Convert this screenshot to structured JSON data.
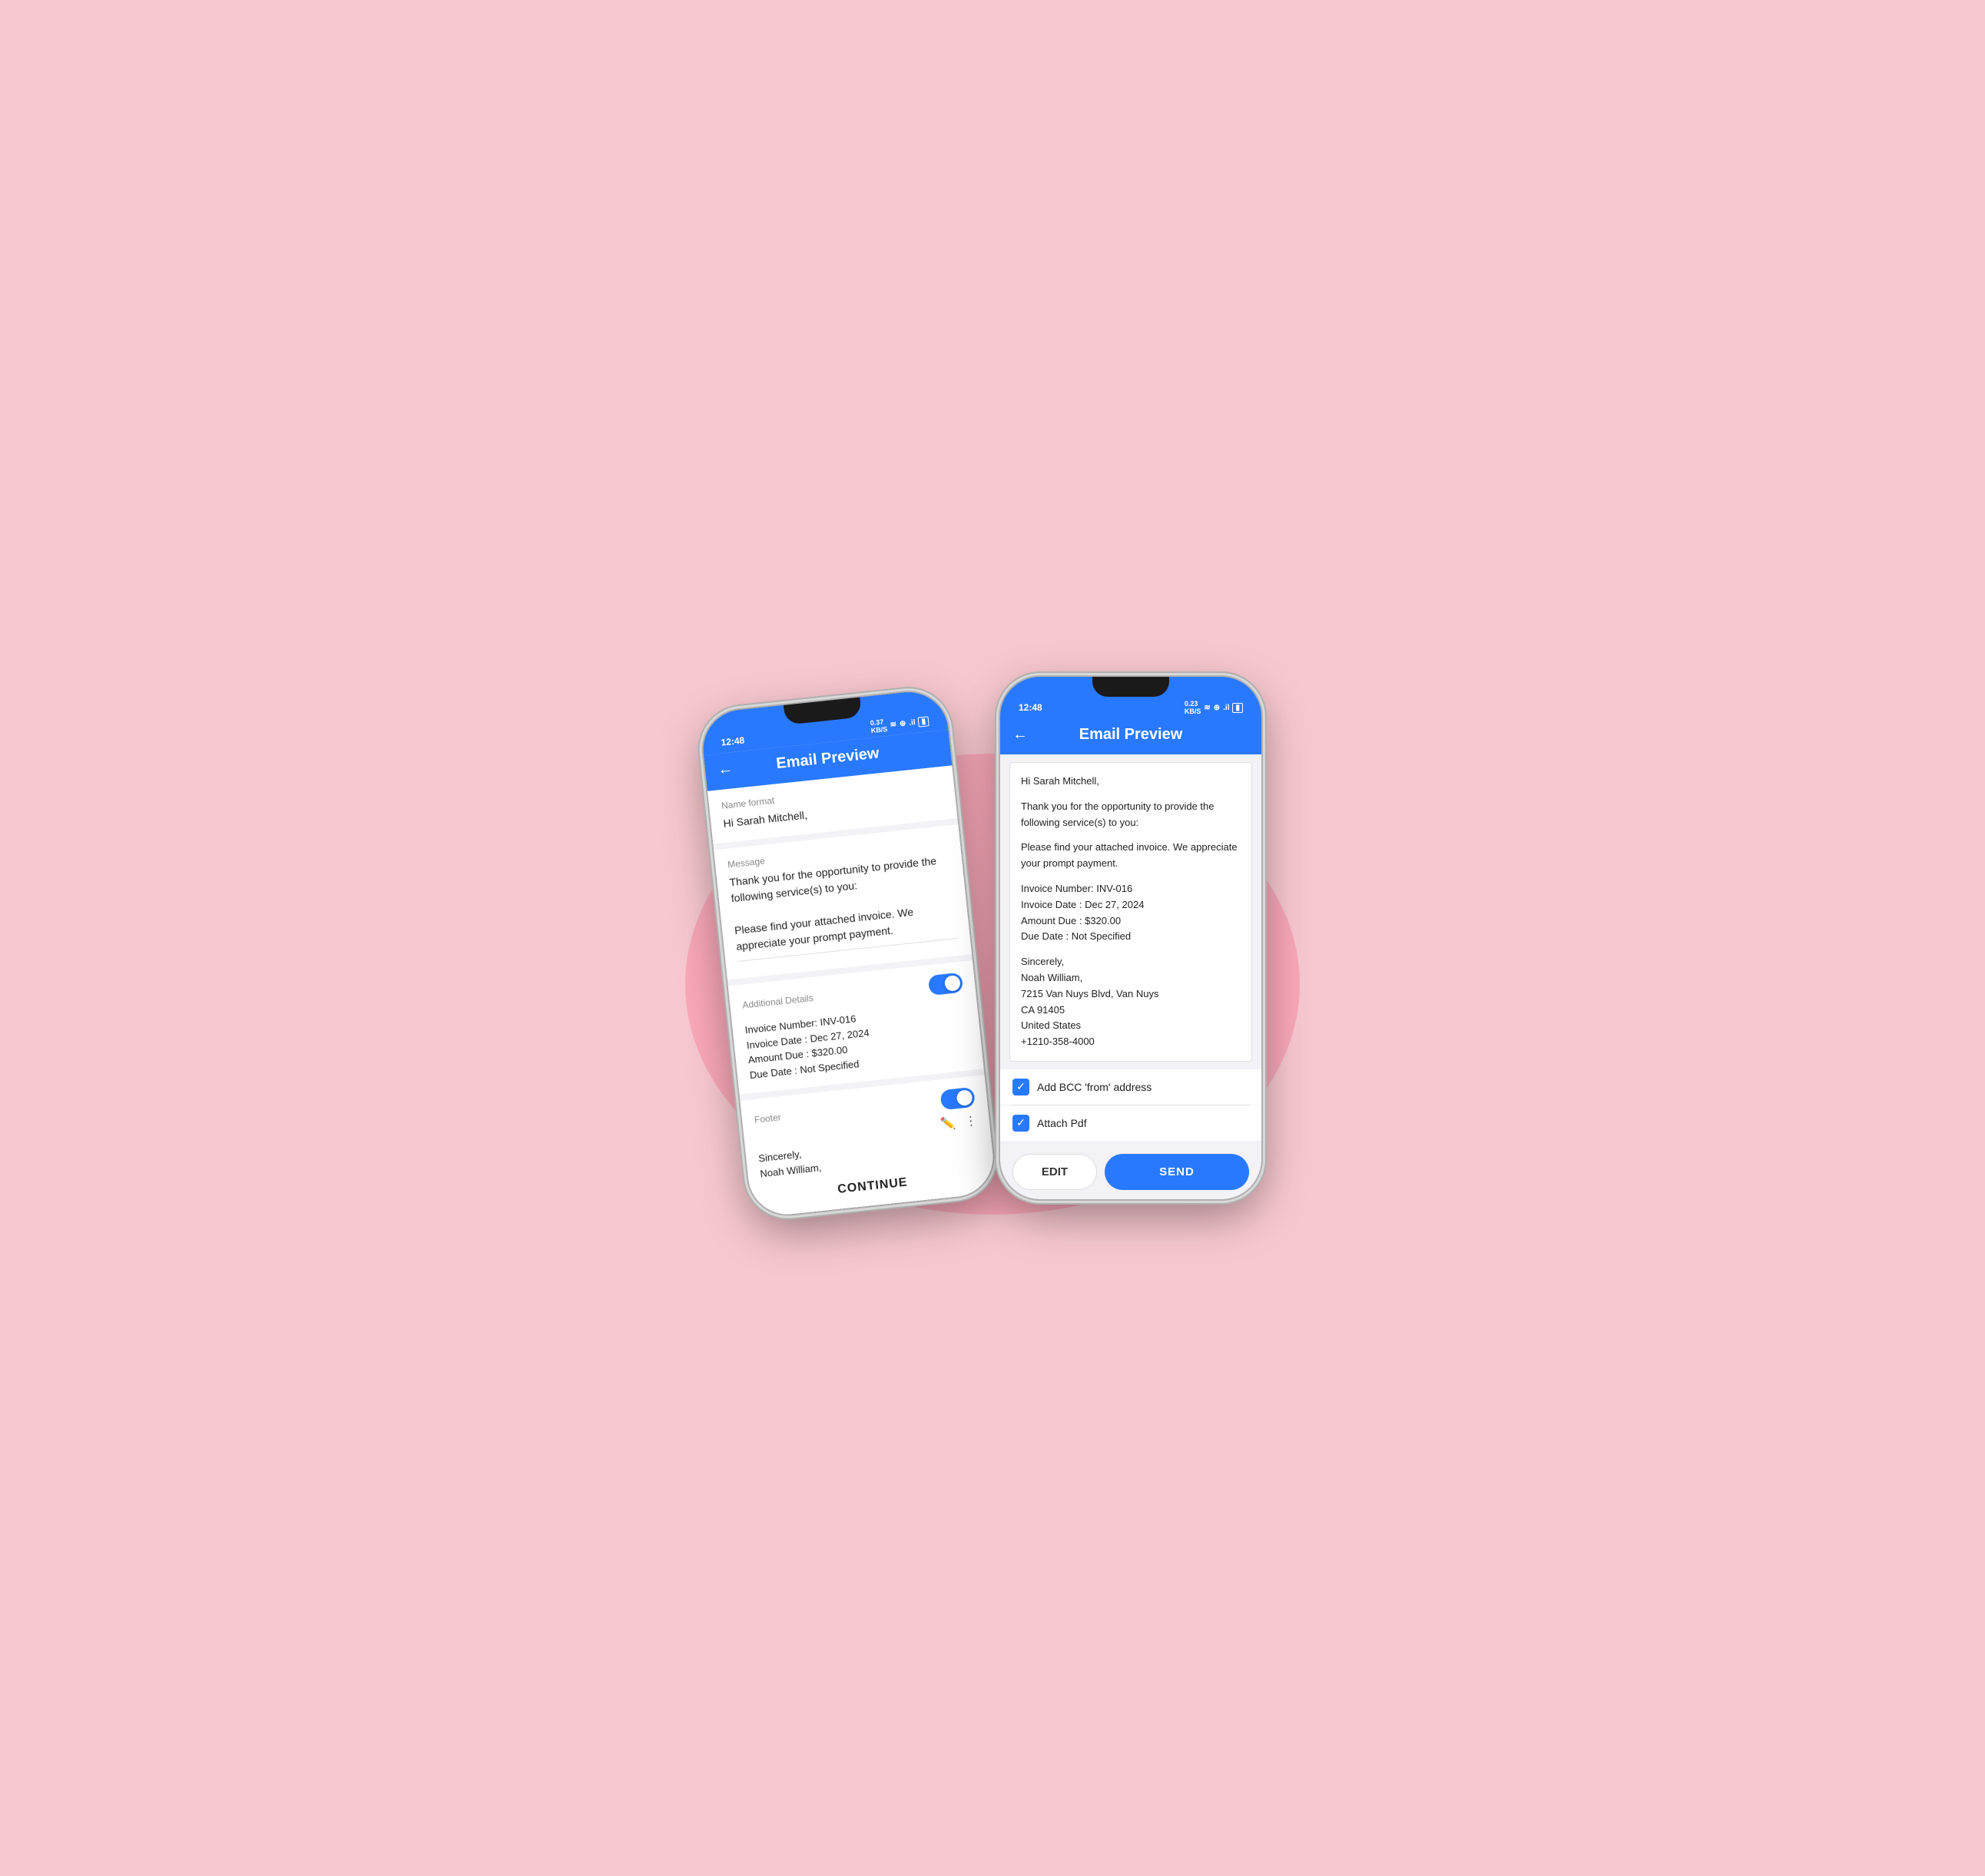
{
  "scene": {
    "background_color": "#f8c8d0"
  },
  "left_phone": {
    "status_bar": {
      "time": "12:48",
      "icons": "0.37 KB/S ≋ ⊕ .il 🔋"
    },
    "header": {
      "back_label": "←",
      "title": "Email Preview"
    },
    "sections": [
      {
        "id": "name_format",
        "label": "Name format",
        "value": "Hi Sarah Mitchell,"
      },
      {
        "id": "message",
        "label": "Message",
        "value": "Thank you for the opportunity to provide the following service(s) to you:\n\nPlease find your attached invoice. We appreciate your prompt payment."
      },
      {
        "id": "additional_details",
        "label": "Additional Details",
        "toggle": true,
        "toggle_on": true,
        "value": "Invoice Number: INV-016\nInvoice Date : Dec 27, 2024\nAmount Due : $320.00\nDue Date : Not Specified"
      },
      {
        "id": "footer",
        "label": "Footer",
        "toggle": true,
        "toggle_on": true,
        "has_edit_icons": true,
        "value": "Sincerely,\nNoah William,"
      }
    ],
    "continue_button_label": "CONTINUE"
  },
  "right_phone": {
    "status_bar": {
      "time": "12:48",
      "icons": "0.23 KB/S ≋ ⊕ .il 🔋"
    },
    "header": {
      "back_label": "←",
      "title": "Email Preview"
    },
    "email_preview": {
      "greeting": "Hi Sarah Mitchell,",
      "paragraph1": "Thank you for the opportunity to provide the following service(s) to you:",
      "paragraph2": "Please find your attached invoice. We appreciate your prompt payment.",
      "invoice_number": "Invoice Number: INV-016",
      "invoice_date": "Invoice Date : Dec 27, 2024",
      "amount_due": "Amount Due : $320.00",
      "due_date": "Due Date : Not Specified",
      "footer_greeting": "Sincerely,",
      "footer_name": "Noah William,",
      "footer_address1": "7215 Van Nuys Blvd, Van Nuys",
      "footer_address2": "CA 91405",
      "footer_country": "United States",
      "footer_phone": "+1210-358-4000"
    },
    "checkboxes": [
      {
        "id": "bcc",
        "label": "Add BCC 'from' address",
        "checked": true
      },
      {
        "id": "pdf",
        "label": "Attach Pdf",
        "checked": true
      }
    ],
    "buttons": {
      "edit_label": "EDIT",
      "send_label": "SEND"
    }
  }
}
